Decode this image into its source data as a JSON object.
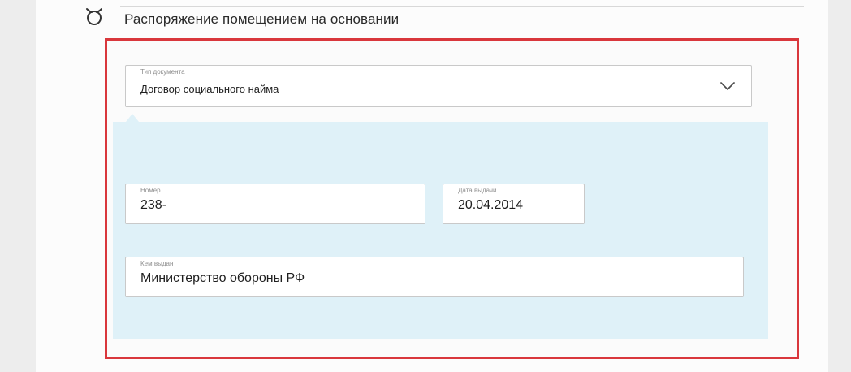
{
  "section": {
    "title": "Распоряжение помещением на основании",
    "icon": "dropdown-toggle-icon"
  },
  "form": {
    "document_type": {
      "label": "Тип документа",
      "value": "Договор социального найма",
      "icon": "chevron-down-icon"
    },
    "number": {
      "label": "Номер",
      "value": "238-"
    },
    "issue_date": {
      "label": "Дата выдачи",
      "value": "20.04.2014"
    },
    "issued_by": {
      "label": "Кем выдан",
      "value": "Министерство обороны РФ"
    }
  },
  "colors": {
    "highlight_border": "#d9373c",
    "panel_background": "#dff1f8",
    "field_border": "#c9c9c9",
    "label_text": "#8e8e8e",
    "value_text": "#1f1f1f"
  }
}
